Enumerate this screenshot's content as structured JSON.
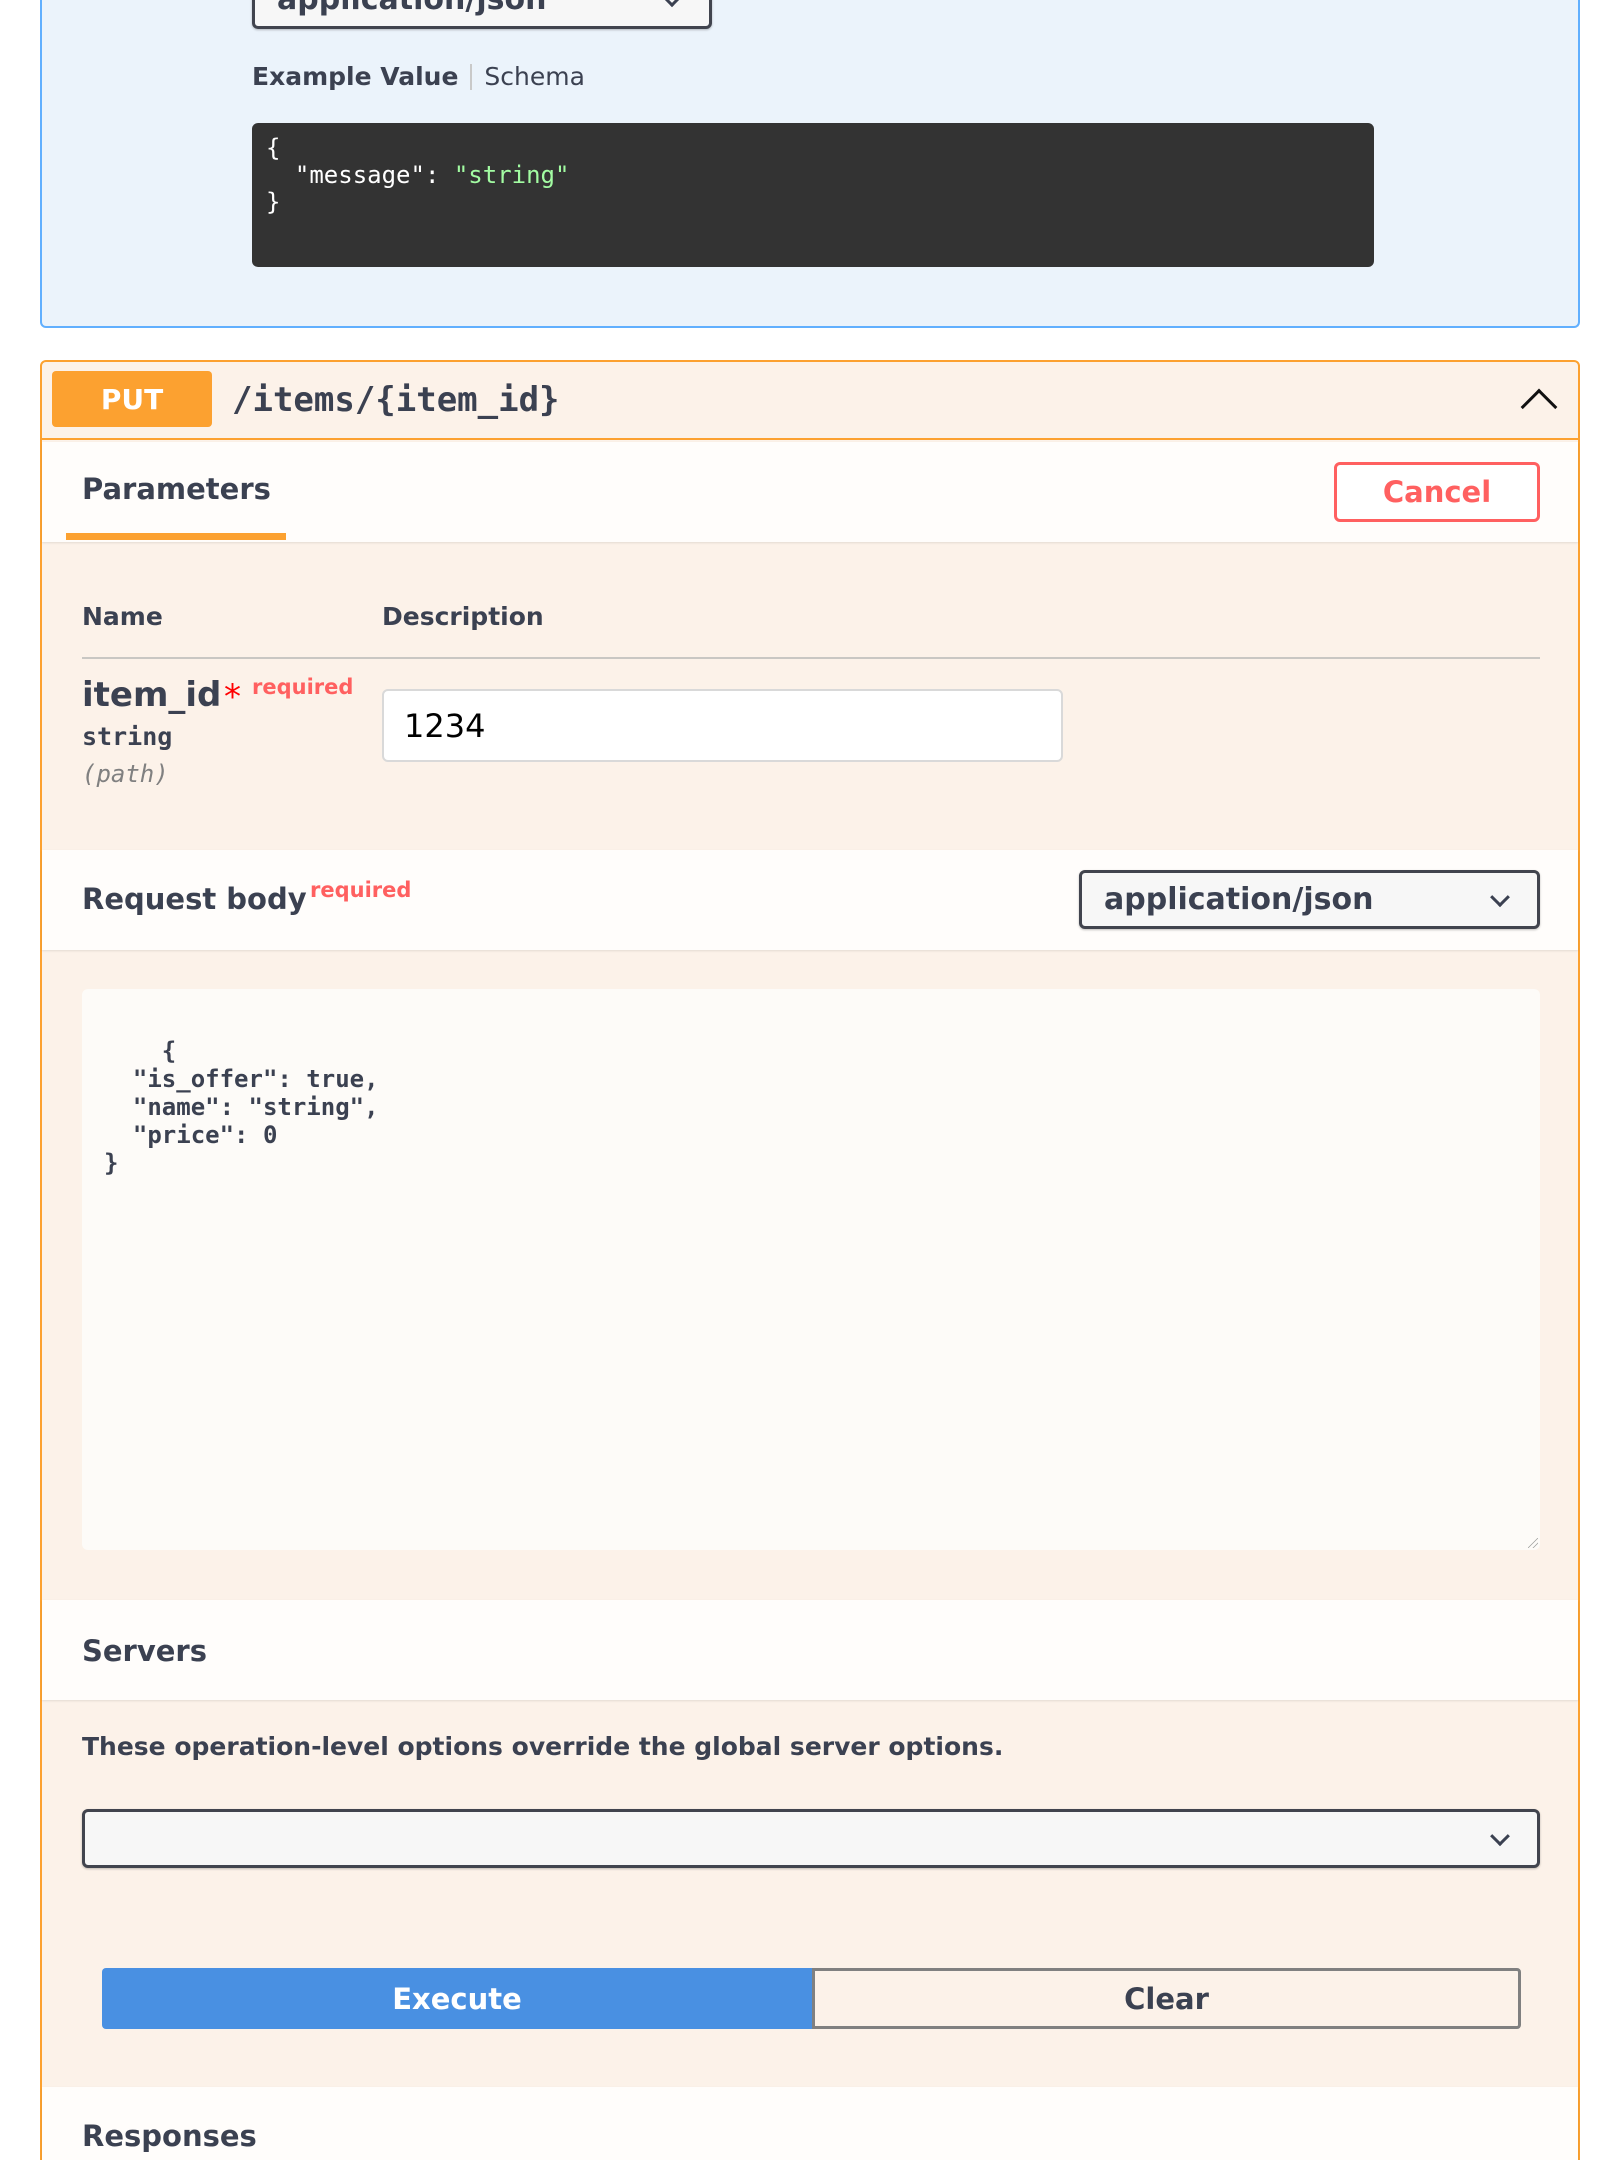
{
  "get_block": {
    "media_type": "application/json",
    "tab_example": "Example Value",
    "tab_schema": "Schema",
    "example_open": "{",
    "example_key": "\"message\"",
    "example_colon": ": ",
    "example_value": "\"string\"",
    "example_close": "}"
  },
  "put": {
    "method": "PUT",
    "path": "/items/{item_id}",
    "parameters_tab": "Parameters",
    "cancel_label": "Cancel",
    "col_name": "Name",
    "col_description": "Description",
    "param": {
      "name": "item_id",
      "star": "*",
      "required": "required",
      "type": "string",
      "in": "(path)",
      "value": "1234"
    },
    "request_body_title": "Request body",
    "request_body_required": "required",
    "request_body_media_type": "application/json",
    "request_body_value": "{\n  \"is_offer\": true,\n  \"name\": \"string\",\n  \"price\": 0\n}",
    "servers_title": "Servers",
    "servers_note": "These operation-level options override the global server options.",
    "servers_selected": "",
    "execute_label": "Execute",
    "clear_label": "Clear",
    "responses_title": "Responses"
  },
  "colors": {
    "put_accent": "#fca130",
    "get_accent": "#61affe",
    "execute": "#4990e2",
    "cancel": "#ff6060"
  }
}
